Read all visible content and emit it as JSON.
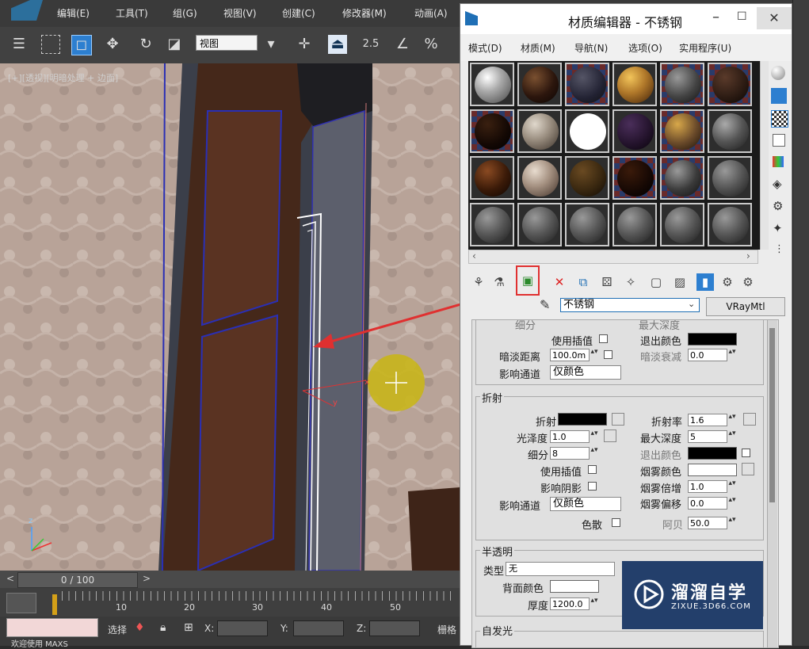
{
  "main_menu": [
    "编辑(E)",
    "工具(T)",
    "组(G)",
    "视图(V)",
    "创建(C)",
    "修改器(M)",
    "动画(A)"
  ],
  "toolbar": {
    "view_select": "视图",
    "snap_num": "2.5",
    "percent_symbol": "%"
  },
  "viewport": {
    "label": "[+][透视][明暗处理 + 边面]",
    "axis_x": "x",
    "axis_y": "y",
    "axis_z": "z"
  },
  "timeline": {
    "frame": "0 / 100",
    "prev": "<",
    "next": ">",
    "ticks": [
      "10",
      "20",
      "30",
      "40",
      "50"
    ]
  },
  "statusbar": {
    "select_label": "选择",
    "x_label": "X:",
    "y_label": "Y:",
    "z_label": "Z:",
    "grid_label": "栅格",
    "welcome": "欢迎使用 MAXS"
  },
  "material_editor": {
    "title": "材质编辑器 - 不锈钢",
    "menu": [
      "模式(D)",
      "材质(M)",
      "导航(N)",
      "选项(O)",
      "实用程序(U)"
    ],
    "material_name": "不锈钢",
    "material_type": "VRayMtl",
    "reflection_partial": {
      "subdiv": "细分",
      "max_depth": "最大深度",
      "use_interp": "使用插值",
      "exit_color": "退出颜色",
      "dim_distance": "暗淡距离",
      "dim_distance_val": "100.0m",
      "dim_falloff": "暗淡衰减",
      "dim_falloff_val": "0.0",
      "affect_channels": "影响通道",
      "affect_channels_val": "仅颜色"
    },
    "refraction": {
      "group": "折射",
      "refract": "折射",
      "ior": "折射率",
      "ior_val": "1.6",
      "glossiness": "光泽度",
      "glossiness_val": "1.0",
      "max_depth": "最大深度",
      "max_depth_val": "5",
      "subdiv": "细分",
      "subdiv_val": "8",
      "exit_color": "退出颜色",
      "use_interp": "使用插值",
      "fog_color": "烟雾颜色",
      "affect_shadows": "影响阴影",
      "fog_multiplier": "烟雾倍增",
      "fog_multiplier_val": "1.0",
      "affect_channels": "影响通道",
      "affect_channels_val": "仅颜色",
      "fog_bias": "烟雾偏移",
      "fog_bias_val": "0.0",
      "dispersion": "色散",
      "abbe": "阿贝",
      "abbe_val": "50.0"
    },
    "translucency": {
      "group": "半透明",
      "type": "类型",
      "type_val": "无",
      "back_color": "背面颜色",
      "thickness": "厚度",
      "thickness_val": "1200.0"
    },
    "self_illum": {
      "group": "自发光"
    }
  },
  "watermark": {
    "title": "溜溜自学",
    "url": "ZIXUE.3D66.COM"
  },
  "colors": {
    "accent": "#1f6fb5",
    "highlight_box": "#e03030",
    "arrow": "#e03030"
  }
}
